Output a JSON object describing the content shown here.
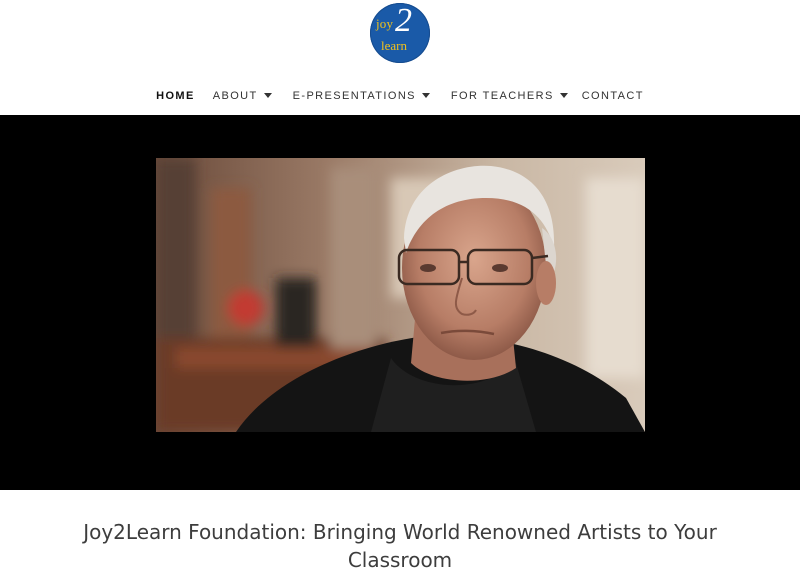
{
  "logo": {
    "joy": "joy",
    "two": "2",
    "learn": "learn"
  },
  "nav": {
    "items": [
      {
        "label": "HOME",
        "active": true,
        "has_dropdown": false
      },
      {
        "label": "ABOUT",
        "active": false,
        "has_dropdown": true
      },
      {
        "label": "E-PRESENTATIONS",
        "active": false,
        "has_dropdown": true
      },
      {
        "label": "FOR TEACHERS",
        "active": false,
        "has_dropdown": true
      },
      {
        "label": "CONTACT",
        "active": false,
        "has_dropdown": false
      }
    ]
  },
  "video": {
    "icon": "video-player"
  },
  "main": {
    "title": "Joy2Learn Foundation: Bringing World Renowned Artists to Your Classroom"
  },
  "colors": {
    "logo_bg": "#1a5aa8",
    "logo_accent": "#f2c21a",
    "video_band": "#000000",
    "title_text": "#3d3d3d"
  }
}
